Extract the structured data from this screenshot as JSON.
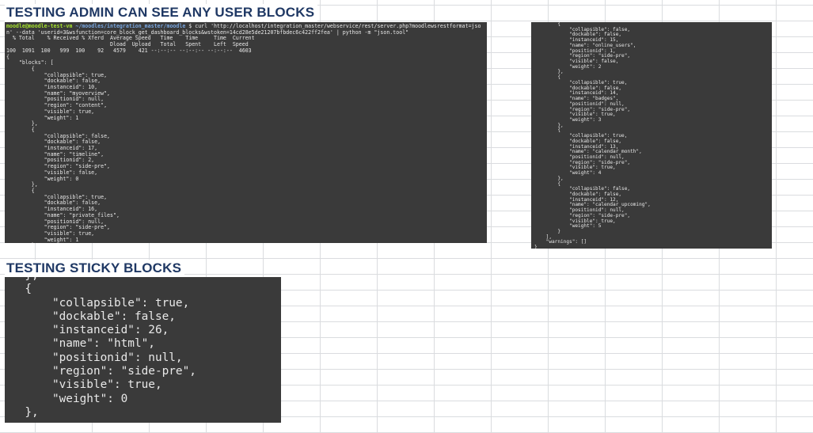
{
  "headings": {
    "admin_blocks": "TESTING ADMIN CAN SEE ANY USER BLOCKS",
    "sticky_blocks": "TESTING STICKY BLOCKS"
  },
  "terminal_1": {
    "prompt_user": "moodle@moodle-test-vm",
    "prompt_path": " ~/moodles/integration_master/moodle",
    "prompt_symbol": " $ ",
    "command_line_1": "curl 'http://localhost/integration_master/webservice/rest/server.php?moodlewsrestformat=jso",
    "command_line_2": "n' --data 'userid=3&wsfunction=core_block_get_dashboard_blocks&wstoken=14cd28e5de21207bfbdec6c422ff2fea' | python -m \"json.tool\"",
    "curl_header_1": "  % Total    % Received % Xferd  Average Speed   Time    Time     Time  Current",
    "curl_header_2": "                                 Dload  Upload   Total   Spent    Left  Speed",
    "curl_progress": "100  1091  100   999  100    92   4579    421 --:--:-- --:--:-- --:--:--  4603",
    "json_text": "{\n    \"blocks\": [\n        {\n            \"collapsible\": true,\n            \"dockable\": false,\n            \"instanceid\": 10,\n            \"name\": \"myoverview\",\n            \"positionid\": null,\n            \"region\": \"content\",\n            \"visible\": true,\n            \"weight\": 1\n        },\n        {\n            \"collapsible\": false,\n            \"dockable\": false,\n            \"instanceid\": 17,\n            \"name\": \"timeline\",\n            \"positionid\": 2,\n            \"region\": \"side-pre\",\n            \"visible\": false,\n            \"weight\": 0\n        },\n        {\n            \"collapsible\": true,\n            \"dockable\": false,\n            \"instanceid\": 16,\n            \"name\": \"private_files\",\n            \"positionid\": null,\n            \"region\": \"side-pre\",\n            \"visible\": true,\n            \"weight\": 1\n        },"
  },
  "terminal_2": {
    "json_text": "        {\n            \"collapsible\": false,\n            \"dockable\": false,\n            \"instanceid\": 15,\n            \"name\": \"online_users\",\n            \"positionid\": 1,\n            \"region\": \"side-pre\",\n            \"visible\": false,\n            \"weight\": 2\n        },\n        {\n            \"collapsible\": true,\n            \"dockable\": false,\n            \"instanceid\": 14,\n            \"name\": \"badges\",\n            \"positionid\": null,\n            \"region\": \"side-pre\",\n            \"visible\": true,\n            \"weight\": 3\n        },\n        {\n            \"collapsible\": true,\n            \"dockable\": false,\n            \"instanceid\": 13,\n            \"name\": \"calendar_month\",\n            \"positionid\": null,\n            \"region\": \"side-pre\",\n            \"visible\": true,\n            \"weight\": 4\n        },\n        {\n            \"collapsible\": false,\n            \"dockable\": false,\n            \"instanceid\": 12,\n            \"name\": \"calendar_upcoming\",\n            \"positionid\": null,\n            \"region\": \"side-pre\",\n            \"visible\": true,\n            \"weight\": 5\n        }\n    ],\n    \"warnings\": []\n}"
  },
  "terminal_3": {
    "json_text": "  },\n  {\n      \"collapsible\": true,\n      \"dockable\": false,\n      \"instanceid\": 26,\n      \"name\": \"html\",\n      \"positionid\": null,\n      \"region\": \"side-pre\",\n      \"visible\": true,\n      \"weight\": 0\n  },"
  },
  "colors": {
    "heading": "#1f3864",
    "terminal_bg": "#3a3a3a",
    "terminal_text": "#e8e8e8",
    "grid_line": "#dadcdf"
  }
}
